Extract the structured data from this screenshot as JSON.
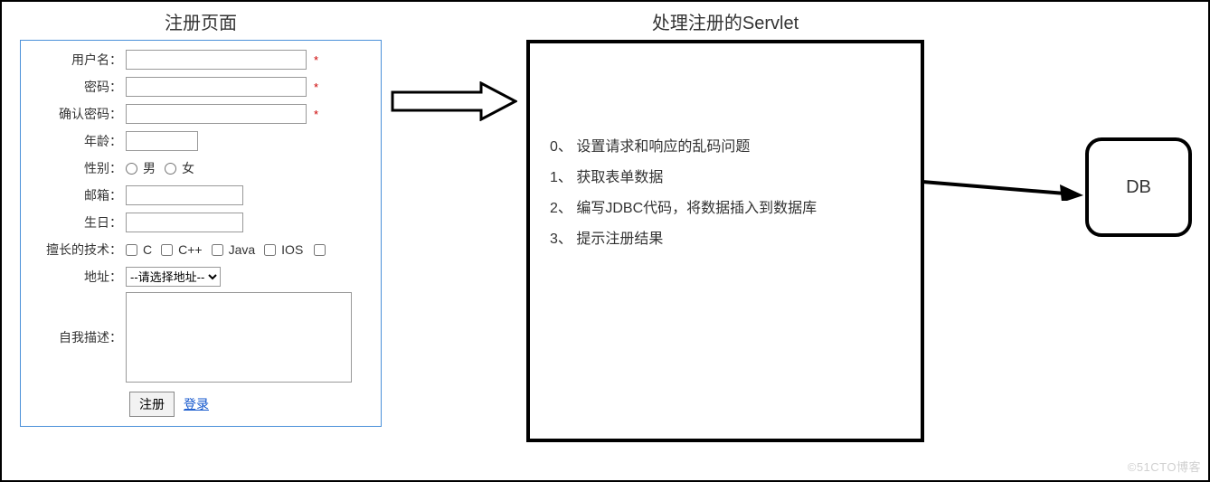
{
  "form": {
    "title": "注册页面",
    "labels": {
      "username": "用户名：",
      "password": "密码：",
      "confirm_password": "确认密码：",
      "age": "年龄：",
      "gender": "性别：",
      "email": "邮箱：",
      "birthday": "生日：",
      "skills": "擅长的技术：",
      "address": "地址：",
      "self_desc": "自我描述："
    },
    "required_mark": "*",
    "gender_options": {
      "male": "男",
      "female": "女"
    },
    "skills_options": {
      "c": "C",
      "cpp": "C++",
      "java": "Java",
      "ios": "IOS"
    },
    "address_selected": "--请选择地址--",
    "submit_label": "注册",
    "login_label": "登录"
  },
  "servlet": {
    "title": "处理注册的Servlet",
    "steps": {
      "s0": "0、 设置请求和响应的乱码问题",
      "s1": "1、 获取表单数据",
      "s2": "2、 编写JDBC代码，将数据插入到数据库",
      "s3": "3、 提示注册结果"
    }
  },
  "db": {
    "label": "DB"
  },
  "watermark": "©51CTO博客"
}
